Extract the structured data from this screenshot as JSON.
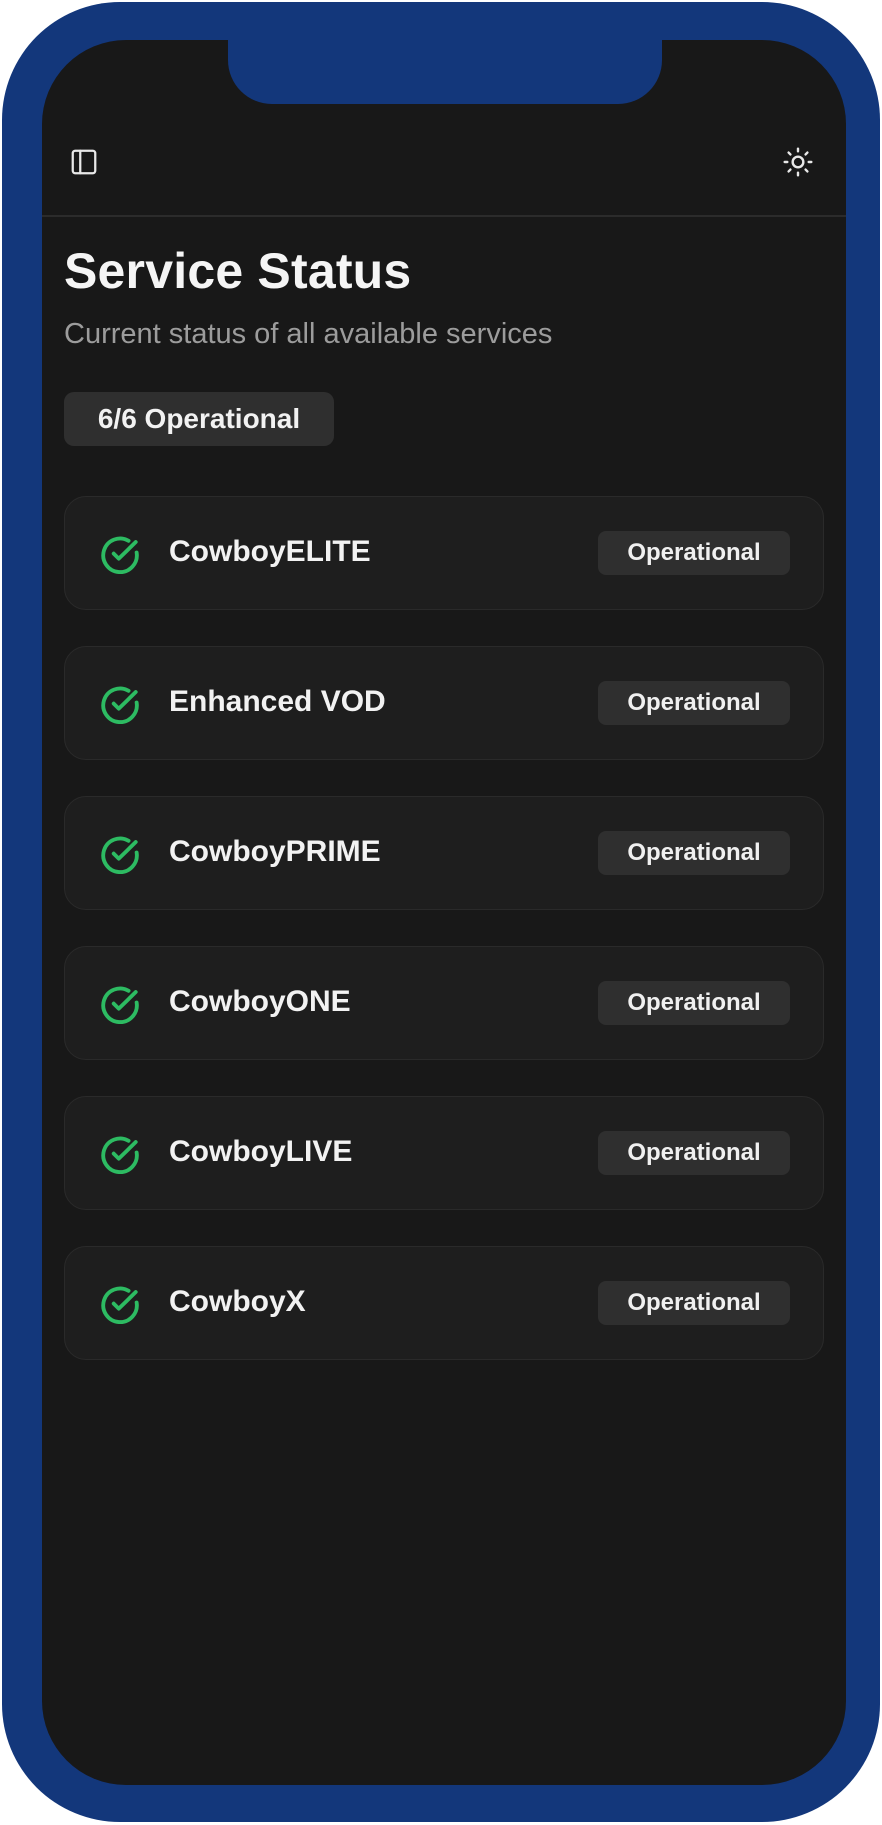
{
  "header": {
    "sidebar_toggle_icon": "sidebar-panel-icon",
    "theme_toggle_icon": "sun-icon"
  },
  "page": {
    "title": "Service Status",
    "subtitle": "Current status of all available services",
    "summary": "6/6 Operational"
  },
  "colors": {
    "device_frame": "#13377b",
    "background": "#181818",
    "card": "#1e1e1e",
    "badge": "#2f2f2f",
    "operational_green": "#2dbb62"
  },
  "services": [
    {
      "name": "CowboyELITE",
      "status": "Operational",
      "icon": "check-circle-icon"
    },
    {
      "name": "Enhanced VOD",
      "status": "Operational",
      "icon": "check-circle-icon"
    },
    {
      "name": "CowboyPRIME",
      "status": "Operational",
      "icon": "check-circle-icon"
    },
    {
      "name": "CowboyONE",
      "status": "Operational",
      "icon": "check-circle-icon"
    },
    {
      "name": "CowboyLIVE",
      "status": "Operational",
      "icon": "check-circle-icon"
    },
    {
      "name": "CowboyX",
      "status": "Operational",
      "icon": "check-circle-icon"
    }
  ]
}
